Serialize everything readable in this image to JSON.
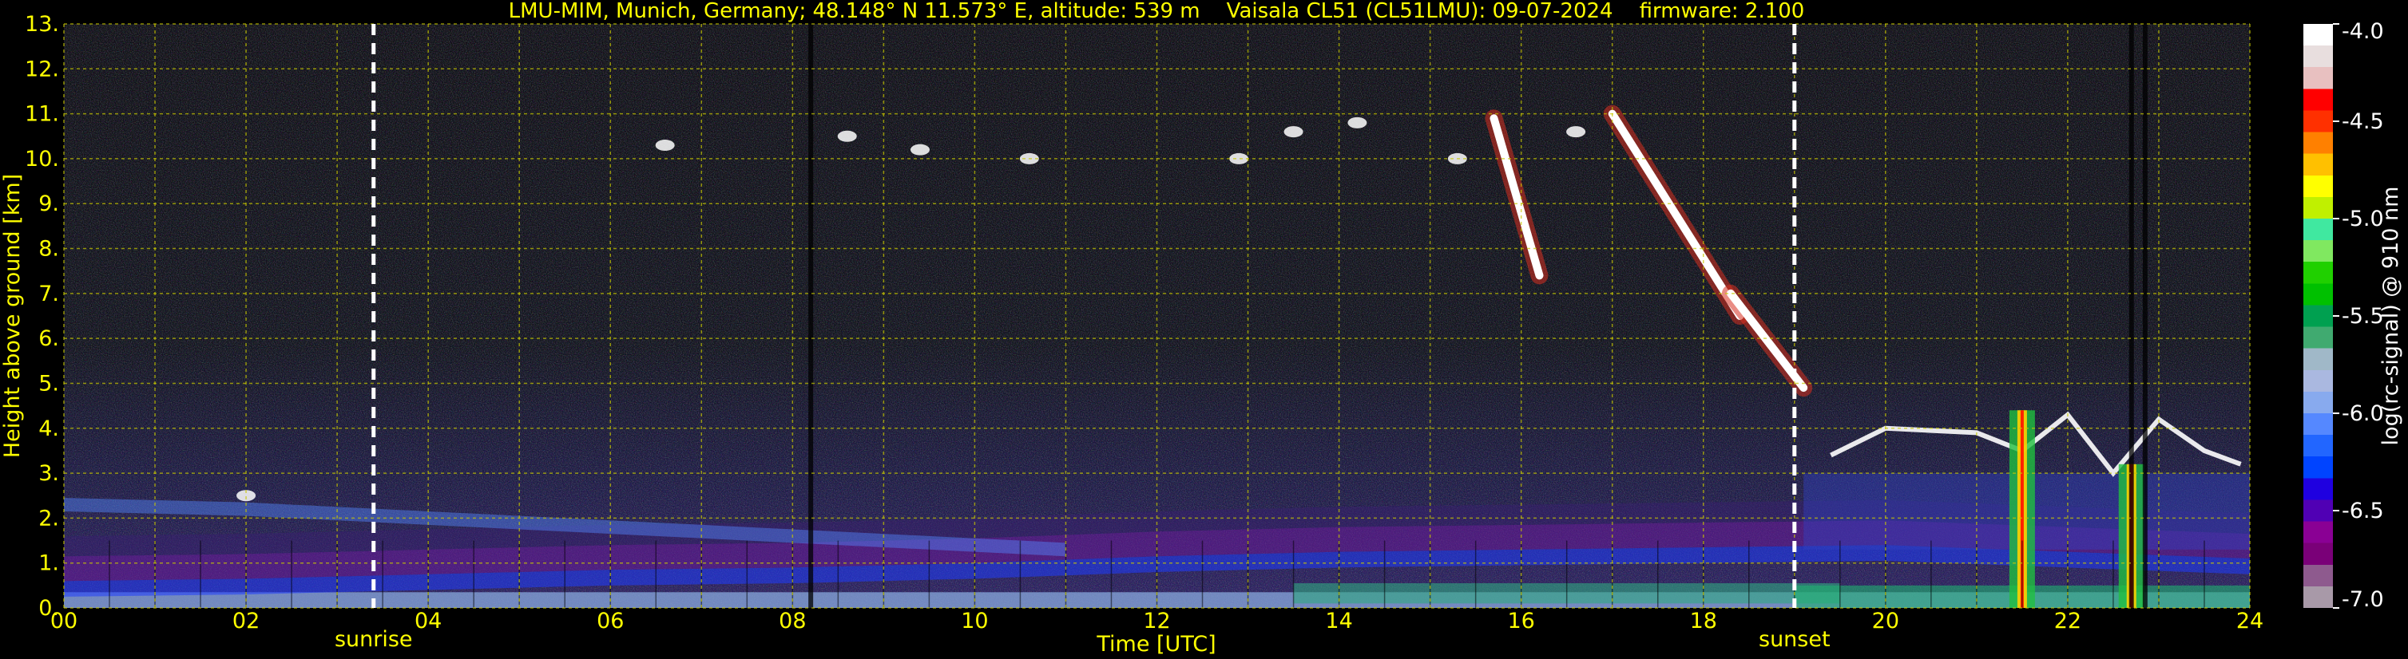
{
  "chart_data": {
    "type": "heatmap",
    "title": "LMU-MIM, Munich, Germany; 48.148° N 11.573° E, altitude: 539 m    Vaisala CL51 (CL51LMU): 09-07-2024    firmware: 2.100",
    "xlabel": "Time [UTC]",
    "ylabel": "Height above ground [km]",
    "xlim": [
      0,
      24
    ],
    "ylim": [
      0,
      13
    ],
    "x_ticks": [
      0,
      2,
      4,
      6,
      8,
      10,
      12,
      14,
      16,
      18,
      20,
      22,
      24
    ],
    "x_tick_labels": [
      "00",
      "02",
      "04",
      "06",
      "08",
      "10",
      "12",
      "14",
      "16",
      "18",
      "20",
      "22",
      "24"
    ],
    "y_ticks": [
      0,
      1,
      2,
      3,
      4,
      5,
      6,
      7,
      8,
      9,
      10,
      11,
      12,
      13
    ],
    "y_tick_labels": [
      "0.",
      "1.",
      "2.",
      "3.",
      "4.",
      "5.",
      "6.",
      "7.",
      "8.",
      "9.",
      "10.",
      "11.",
      "12.",
      "13."
    ],
    "grid": true,
    "events": [
      {
        "label": "sunrise",
        "x": 3.4
      },
      {
        "label": "sunset",
        "x": 19.0
      }
    ],
    "colorbar": {
      "label": "log(rc-signal) @ 910 nm",
      "range": [
        -7.0,
        -4.0
      ],
      "ticks": [
        -7.0,
        -6.5,
        -6.0,
        -5.5,
        -5.0,
        -4.5,
        -4.0
      ],
      "tick_labels": [
        "-7.0",
        "-6.5",
        "-6.0",
        "-5.5",
        "-5.0",
        "-4.5",
        "-4.0"
      ],
      "colors": [
        "#a899a8",
        "#8e5a8e",
        "#7a0078",
        "#8a0094",
        "#5000b4",
        "#1f00e0",
        "#0044ff",
        "#2266ff",
        "#5588ff",
        "#88aaee",
        "#aab8e0",
        "#a0b8c8",
        "#40aa70",
        "#00a050",
        "#00c000",
        "#20d000",
        "#80e860",
        "#40e8a0",
        "#c0f000",
        "#ffff00",
        "#ffc000",
        "#ff8000",
        "#ff3000",
        "#ff0000",
        "#e8c0c0",
        "#e8dede",
        "#ffffff"
      ]
    },
    "features": {
      "boundary_layer": [
        [
          0,
          0.6
        ],
        [
          2,
          0.65
        ],
        [
          4,
          0.75
        ],
        [
          6,
          0.85
        ],
        [
          8,
          0.9
        ],
        [
          10,
          1.0
        ],
        [
          12,
          1.15
        ],
        [
          14,
          1.25
        ],
        [
          16,
          1.3
        ],
        [
          18,
          1.35
        ],
        [
          20,
          1.4
        ],
        [
          22,
          1.25
        ],
        [
          24,
          1.1
        ]
      ],
      "residual_layer": [
        [
          0,
          2.3
        ],
        [
          2,
          2.2
        ],
        [
          4,
          2.0
        ],
        [
          6,
          1.8
        ],
        [
          8,
          1.6
        ],
        [
          10,
          1.4
        ],
        [
          11,
          1.3
        ]
      ],
      "cirrus_streaks": [
        {
          "x": [
            15.7,
            16.2
          ],
          "y": [
            10.9,
            7.4
          ]
        },
        {
          "x": [
            17.0,
            18.4
          ],
          "y": [
            11.0,
            6.5
          ]
        },
        {
          "x": [
            18.3,
            19.1
          ],
          "y": [
            7.0,
            4.9
          ]
        }
      ],
      "evening_cloud_top": [
        [
          19.4,
          3.4
        ],
        [
          20.0,
          4.0
        ],
        [
          21.0,
          3.9
        ],
        [
          21.5,
          3.5
        ],
        [
          22.0,
          4.3
        ],
        [
          22.5,
          3.0
        ],
        [
          23.0,
          4.2
        ],
        [
          23.5,
          3.5
        ],
        [
          23.9,
          3.2
        ]
      ],
      "precip_shafts": [
        {
          "x": 21.5,
          "top": 4.4
        },
        {
          "x": 22.7,
          "top": 3.2
        }
      ]
    }
  }
}
